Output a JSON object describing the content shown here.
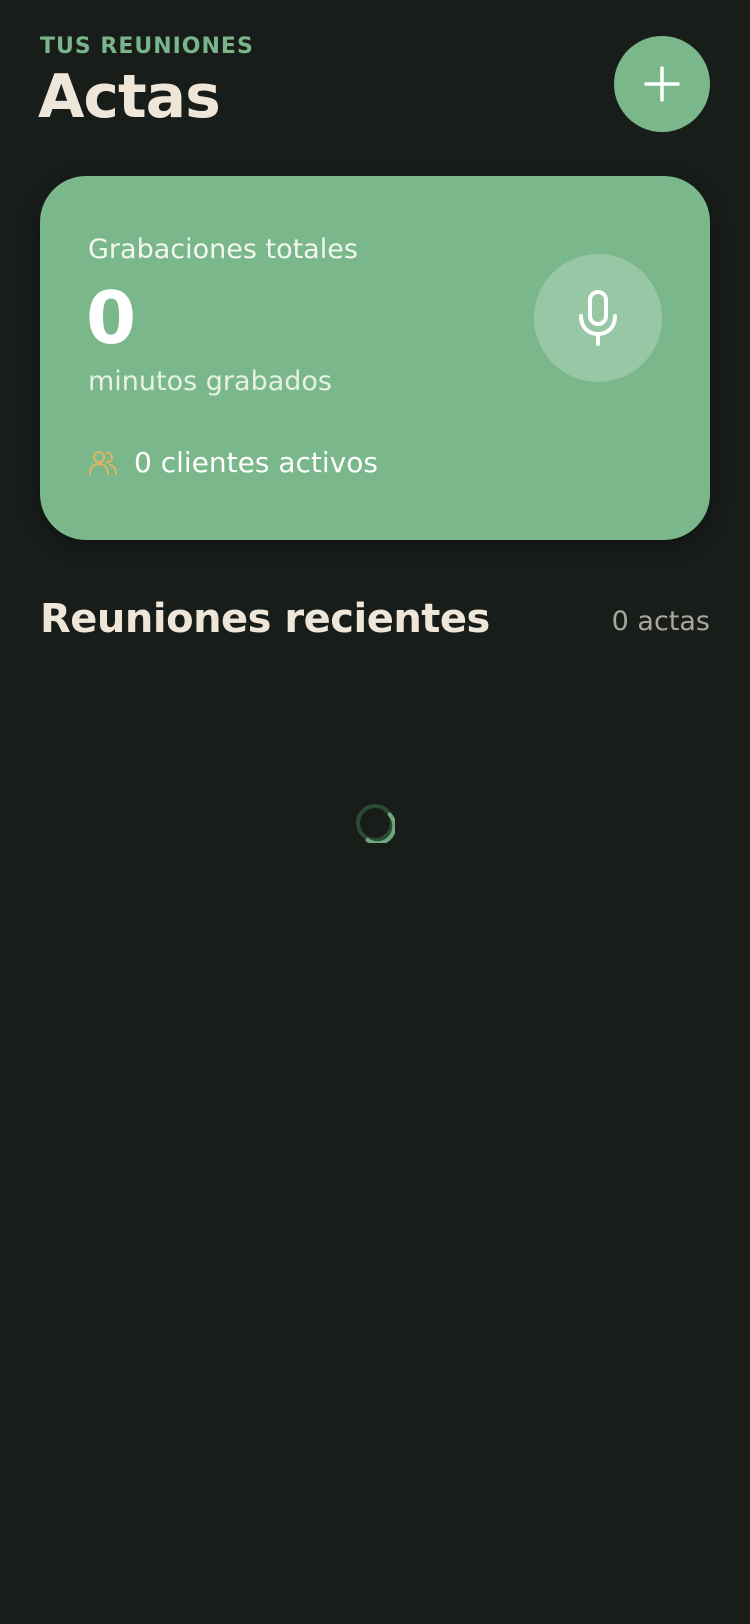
{
  "header": {
    "eyebrow": "TUS REUNIONES",
    "title": "Actas",
    "add_button_icon": "plus-icon"
  },
  "stats_card": {
    "label": "Grabaciones totales",
    "value": "0",
    "unit": "minutos grabados",
    "clients_text": "0 clientes activos",
    "clients_icon": "users-icon",
    "mic_icon": "microphone-icon"
  },
  "recent": {
    "title": "Reuniones recientes",
    "count": "0 actas",
    "loading_icon": "loading-spinner-icon"
  },
  "colors": {
    "background": "#181d1a",
    "accent": "#7ab88b",
    "heading": "#ede6d9",
    "clients_icon": "#e0b45f"
  }
}
